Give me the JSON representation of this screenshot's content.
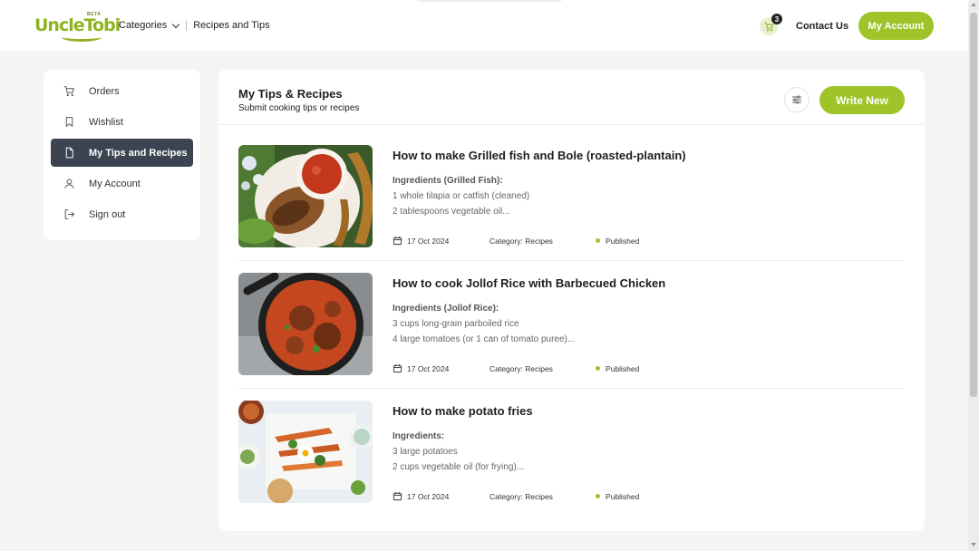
{
  "header": {
    "logo_text": "UncleTobi",
    "logo_beta": "BETA",
    "nav_categories": "Categories",
    "nav_recipes": "Recipes and Tips",
    "cart_count": "3",
    "contact": "Contact Us",
    "account_button": "My Account"
  },
  "sidebar": {
    "items": [
      {
        "label": "Orders",
        "icon": "cart-icon"
      },
      {
        "label": "Wishlist",
        "icon": "bookmark-icon"
      },
      {
        "label": "My Tips and Recipes",
        "icon": "document-icon",
        "active": true
      },
      {
        "label": "My Account",
        "icon": "user-icon"
      },
      {
        "label": "Sign out",
        "icon": "logout-icon"
      }
    ]
  },
  "main": {
    "title": "My Tips & Recipes",
    "subtitle": "Submit cooking tips or recipes",
    "write_button": "Write New",
    "recipes": [
      {
        "title": "How to make Grilled fish and Bole (roasted-plantain)",
        "ingredients_heading": "Ingredients (Grilled Fish):",
        "line1": "1 whole tilapia or catfish (cleaned)",
        "line2": "2 tablespoons vegetable oil...",
        "date": "17 Oct 2024",
        "category": "Category: Recipes",
        "status": "Published"
      },
      {
        "title": "How to cook Jollof Rice with Barbecued Chicken",
        "ingredients_heading": "Ingredients (Jollof Rice):",
        "line1": "3 cups long-grain parboiled rice",
        "line2": "4 large tomatoes (or 1 can of tomato puree)...",
        "date": "17 Oct 2024",
        "category": "Category: Recipes",
        "status": "Published"
      },
      {
        "title": "How to make potato fries",
        "ingredients_heading": "Ingredients:",
        "line1": "3 large potatoes",
        "line2": "2 cups vegetable oil (for frying)...",
        "date": "17 Oct 2024",
        "category": "Category: Recipes",
        "status": "Published"
      }
    ]
  },
  "colors": {
    "brand_green": "#9ec42a",
    "sidebar_active": "#3b4450",
    "page_bg": "#f4f4f4"
  }
}
